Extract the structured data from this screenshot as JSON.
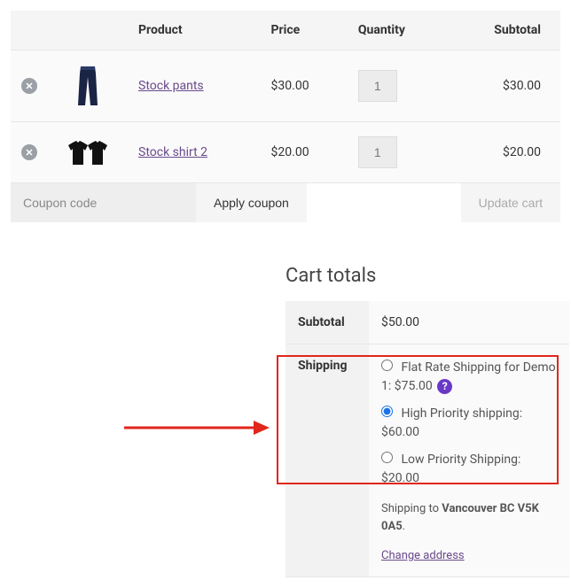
{
  "cart": {
    "headers": {
      "product": "Product",
      "price": "Price",
      "qty": "Quantity",
      "subtotal": "Subtotal"
    },
    "items": [
      {
        "name": "Stock pants",
        "price": "$30.00",
        "qty": "1",
        "subtotal": "$30.00"
      },
      {
        "name": "Stock shirt 2",
        "price": "$20.00",
        "qty": "1",
        "subtotal": "$20.00"
      }
    ],
    "coupon_placeholder": "Coupon code",
    "apply_label": "Apply coupon",
    "update_label": "Update cart"
  },
  "totals": {
    "title": "Cart totals",
    "subtotal_label": "Subtotal",
    "subtotal_value": "$50.00",
    "shipping_label": "Shipping",
    "shipping_options": [
      {
        "label": "Flat Rate Shipping for Demo 1:",
        "price": "$75.00",
        "selected": false,
        "help": true
      },
      {
        "label": "High Priority shipping:",
        "price": "$60.00",
        "selected": true,
        "help": false
      },
      {
        "label": "Low Priority Shipping:",
        "price": "$20.00",
        "selected": false,
        "help": false
      }
    ],
    "shipping_to_prefix": "Shipping to ",
    "shipping_to_dest": "Vancouver BC V5K 0A5",
    "shipping_to_suffix": ".",
    "change_address": "Change address"
  },
  "colors": {
    "accent": "#6a4a8c",
    "highlight": "#e1261c"
  }
}
